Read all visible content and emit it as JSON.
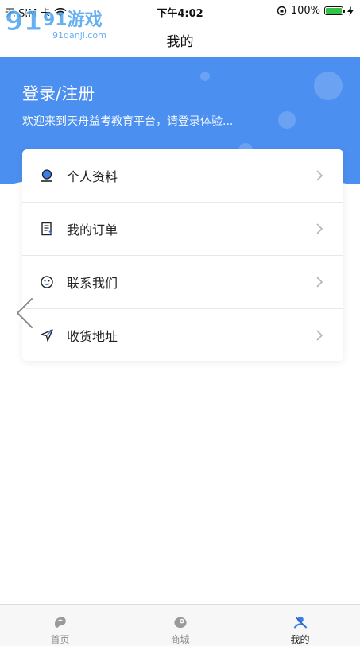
{
  "status_bar": {
    "carrier": "无 SIM 卡",
    "time": "下午4:02",
    "battery_percent": "100%",
    "battery_level": 1.0
  },
  "watermark": {
    "brand": "91游戏",
    "domain": "91danji.com"
  },
  "nav": {
    "title": "我的"
  },
  "header": {
    "login_title": "登录/注册",
    "subtitle": "欢迎来到天舟益考教育平台，请登录体验..."
  },
  "menu": {
    "items": [
      {
        "label": "个人资料",
        "icon": "profile-icon"
      },
      {
        "label": "我的订单",
        "icon": "order-icon"
      },
      {
        "label": "联系我们",
        "icon": "smile-icon"
      },
      {
        "label": "收货地址",
        "icon": "location-arrow-icon"
      }
    ]
  },
  "tabbar": {
    "tabs": [
      {
        "label": "首页",
        "icon": "home-icon"
      },
      {
        "label": "商城",
        "icon": "shop-icon"
      },
      {
        "label": "我的",
        "icon": "user-icon"
      }
    ],
    "active_index": 2
  },
  "colors": {
    "header_blue": "#4b8ff0",
    "battery_green": "#35c24a",
    "active_icon": "#3a7ee8"
  }
}
